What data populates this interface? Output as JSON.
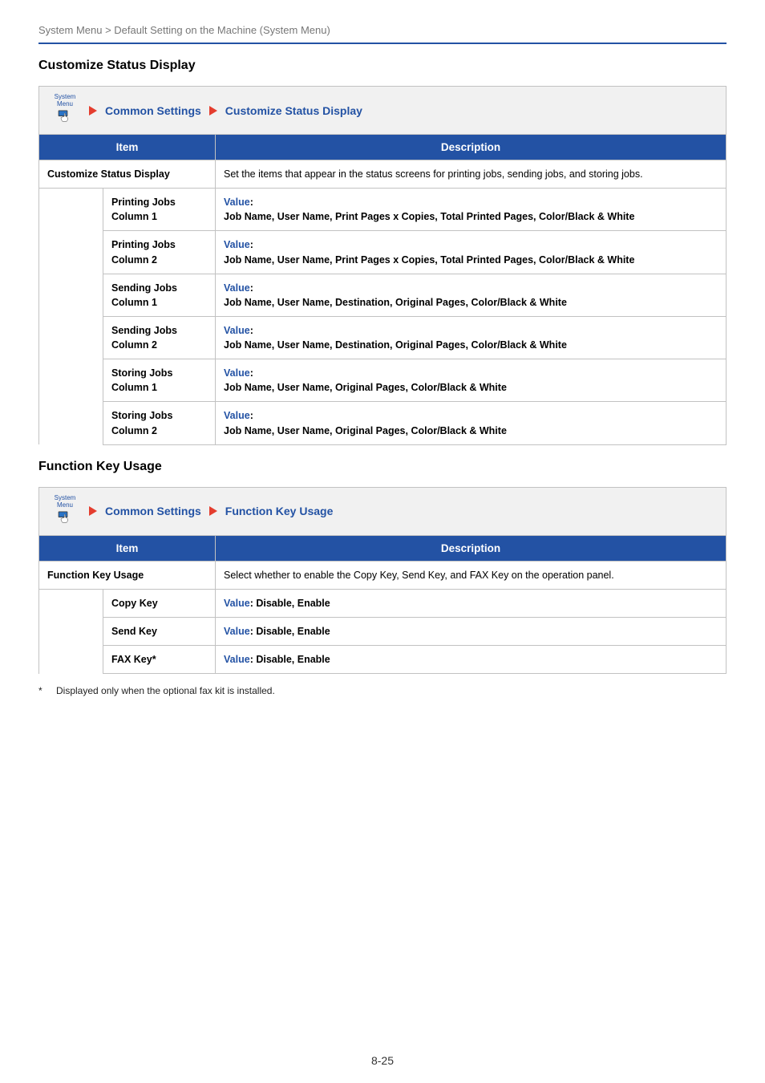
{
  "header": "System Menu > Default Setting on the Machine (System Menu)",
  "page_number": "8-25",
  "icon_label": "System Menu",
  "breadcrumb": {
    "parent": "Common Settings"
  },
  "table_headers": {
    "item": "Item",
    "description": "Description"
  },
  "section1": {
    "heading": "Customize Status Display",
    "crumb_leaf": "Customize Status Display",
    "main_item": "Customize Status Display",
    "main_desc": "Set the items that appear in the status screens for printing jobs, sending jobs, and storing jobs.",
    "rows": [
      {
        "item": "Printing Jobs Column 1",
        "value": "Job Name, User Name, Print Pages x Copies, Total Printed Pages, Color/Black & White"
      },
      {
        "item": "Printing Jobs Column 2",
        "value": "Job Name, User Name, Print Pages x Copies, Total Printed Pages, Color/Black & White"
      },
      {
        "item": "Sending Jobs Column 1",
        "value": "Job Name, User Name, Destination, Original Pages, Color/Black & White"
      },
      {
        "item": "Sending Jobs Column 2",
        "value": "Job Name, User Name, Destination, Original Pages, Color/Black & White"
      },
      {
        "item": "Storing Jobs Column 1",
        "value": "Job Name, User Name, Original Pages, Color/Black & White"
      },
      {
        "item": "Storing Jobs Column 2",
        "value": "Job Name, User Name, Original Pages, Color/Black & White"
      }
    ]
  },
  "section2": {
    "heading": "Function Key Usage",
    "crumb_leaf": "Function Key Usage",
    "main_item": "Function Key Usage",
    "main_desc": "Select whether to enable the Copy Key, Send Key, and FAX Key on the operation panel.",
    "rows": [
      {
        "item": "Copy Key",
        "value": "Disable, Enable"
      },
      {
        "item": "Send Key",
        "value": "Disable, Enable"
      },
      {
        "item": "FAX Key*",
        "value": "Disable, Enable"
      }
    ]
  },
  "footnote": "Displayed only when the optional fax kit is installed.",
  "value_colon": "Value",
  "value_sep": ": "
}
